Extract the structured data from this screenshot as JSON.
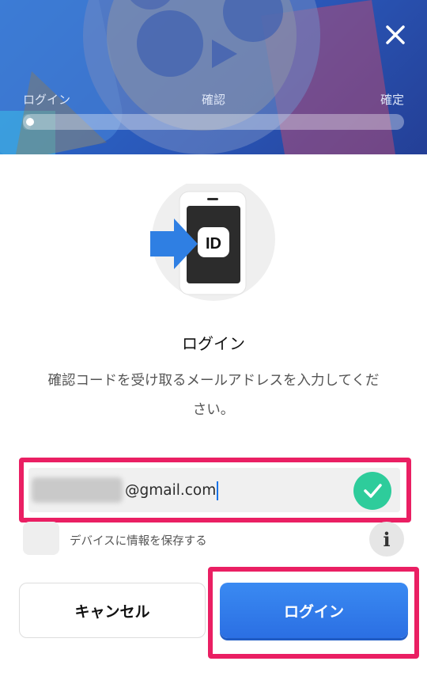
{
  "header": {
    "steps": [
      "ログイン",
      "確認",
      "確定"
    ],
    "progress_fraction": 0.02,
    "close_icon": "close-icon"
  },
  "main": {
    "hero_icon": "phone-id-icon",
    "hero_badge_text": "ID",
    "title": "ログイン",
    "description": "確認コードを受け取るメールアドレスを入力してください。"
  },
  "email_field": {
    "value_suffix": "@gmail.com",
    "valid": true
  },
  "remember": {
    "label": "デバイスに情報を保存する",
    "checked": false
  },
  "buttons": {
    "cancel_label": "キャンセル",
    "login_label": "ログイン"
  },
  "colors": {
    "header": "#2a57b8",
    "primary_button": "#2b6fe3",
    "highlight": "#ea1f63",
    "success": "#2ecc9b"
  }
}
